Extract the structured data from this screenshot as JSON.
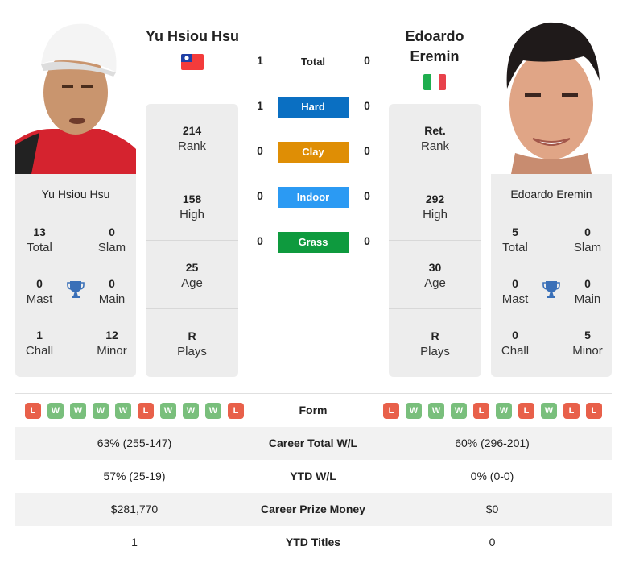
{
  "player1": {
    "name": "Yu Hsiou Hsu",
    "flag": "taiwan-flag",
    "card_name": "Yu Hsiou Hsu",
    "titles": {
      "total": {
        "value": "13",
        "label": "Total"
      },
      "slam": {
        "value": "0",
        "label": "Slam"
      },
      "mast": {
        "value": "0",
        "label": "Mast"
      },
      "main": {
        "value": "0",
        "label": "Main"
      },
      "chall": {
        "value": "1",
        "label": "Chall"
      },
      "minor": {
        "value": "12",
        "label": "Minor"
      }
    },
    "stats": {
      "rank": {
        "value": "214",
        "label": "Rank"
      },
      "high": {
        "value": "158",
        "label": "High"
      },
      "age": {
        "value": "25",
        "label": "Age"
      },
      "plays": {
        "value": "R",
        "label": "Plays"
      }
    },
    "form": [
      "L",
      "W",
      "W",
      "W",
      "W",
      "L",
      "W",
      "W",
      "W",
      "L"
    ]
  },
  "player2": {
    "name_line1": "Edoardo",
    "name_line2": "Eremin",
    "flag": "italy-flag",
    "card_name": "Edoardo Eremin",
    "titles": {
      "total": {
        "value": "5",
        "label": "Total"
      },
      "slam": {
        "value": "0",
        "label": "Slam"
      },
      "mast": {
        "value": "0",
        "label": "Mast"
      },
      "main": {
        "value": "0",
        "label": "Main"
      },
      "chall": {
        "value": "0",
        "label": "Chall"
      },
      "minor": {
        "value": "5",
        "label": "Minor"
      }
    },
    "stats": {
      "rank": {
        "value": "Ret.",
        "label": "Rank"
      },
      "high": {
        "value": "292",
        "label": "High"
      },
      "age": {
        "value": "30",
        "label": "Age"
      },
      "plays": {
        "value": "R",
        "label": "Plays"
      }
    },
    "form": [
      "L",
      "W",
      "W",
      "W",
      "L",
      "W",
      "L",
      "W",
      "L",
      "L"
    ]
  },
  "h2h": {
    "total": {
      "label": "Total",
      "p1": "1",
      "p2": "0"
    },
    "surfaces": [
      {
        "label": "Hard",
        "p1": "1",
        "p2": "0",
        "color": "#0a6fc2"
      },
      {
        "label": "Clay",
        "p1": "0",
        "p2": "0",
        "color": "#df8e05"
      },
      {
        "label": "Indoor",
        "p1": "0",
        "p2": "0",
        "color": "#2b9af3"
      },
      {
        "label": "Grass",
        "p1": "0",
        "p2": "0",
        "color": "#0e9a3e"
      }
    ]
  },
  "comparison": {
    "form_label": "Form",
    "rows": [
      {
        "label": "Career Total W/L",
        "p1": "63% (255-147)",
        "p2": "60% (296-201)"
      },
      {
        "label": "YTD W/L",
        "p1": "57% (25-19)",
        "p2": "0% (0-0)"
      },
      {
        "label": "Career Prize Money",
        "p1": "$281,770",
        "p2": "$0"
      },
      {
        "label": "YTD Titles",
        "p1": "1",
        "p2": "0"
      }
    ]
  },
  "colors": {
    "win": "#79bf7c",
    "loss": "#e8604a",
    "trophy": "#3a70b8",
    "card_bg": "#ededed"
  }
}
